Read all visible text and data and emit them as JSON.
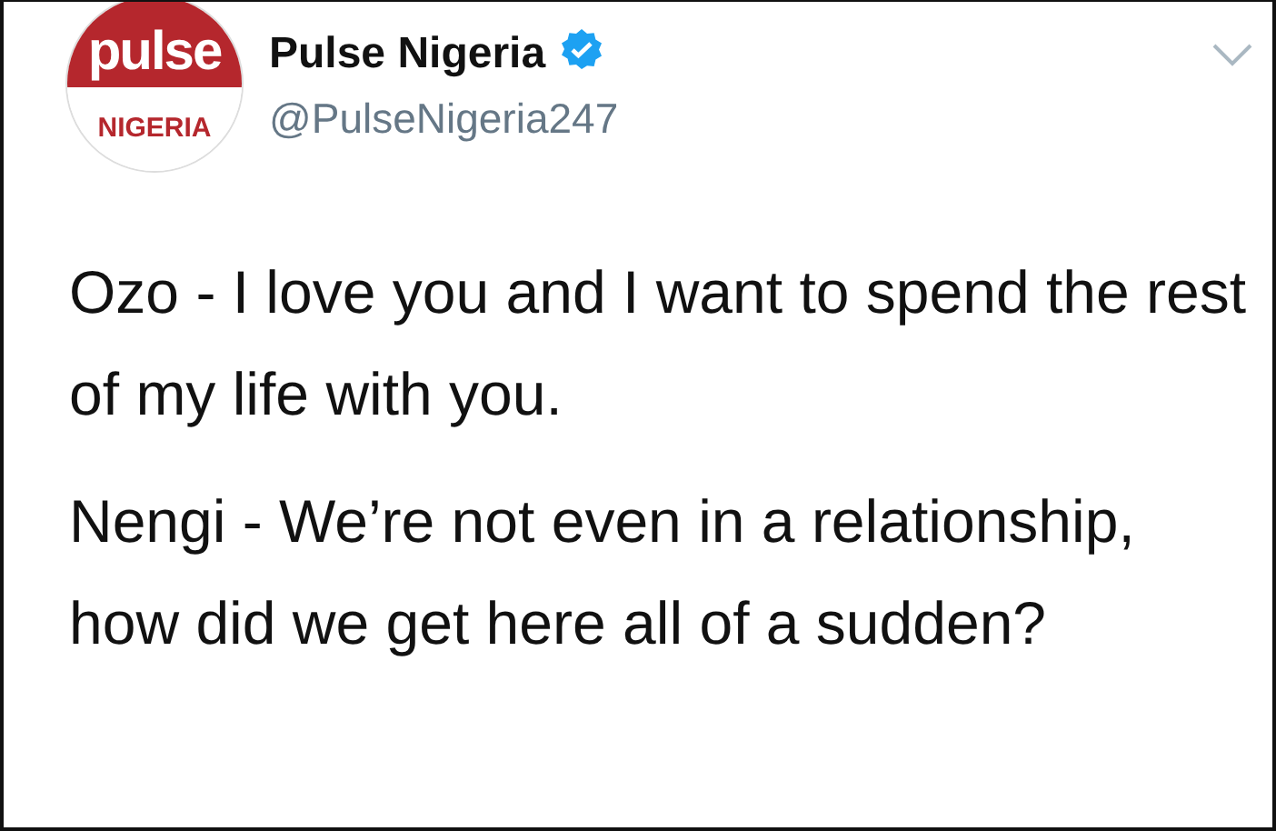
{
  "tweet": {
    "avatar": {
      "top": "pulse",
      "bottom": "NIGERIA"
    },
    "name": "Pulse Nigeria",
    "verified": true,
    "handle": "@PulseNigeria247",
    "paragraphs": [
      "Ozo - I love you and I want to spend the rest of my life with you.",
      "Nengi - We’re not even in a relationship, how did we get here all of a sudden?"
    ]
  }
}
